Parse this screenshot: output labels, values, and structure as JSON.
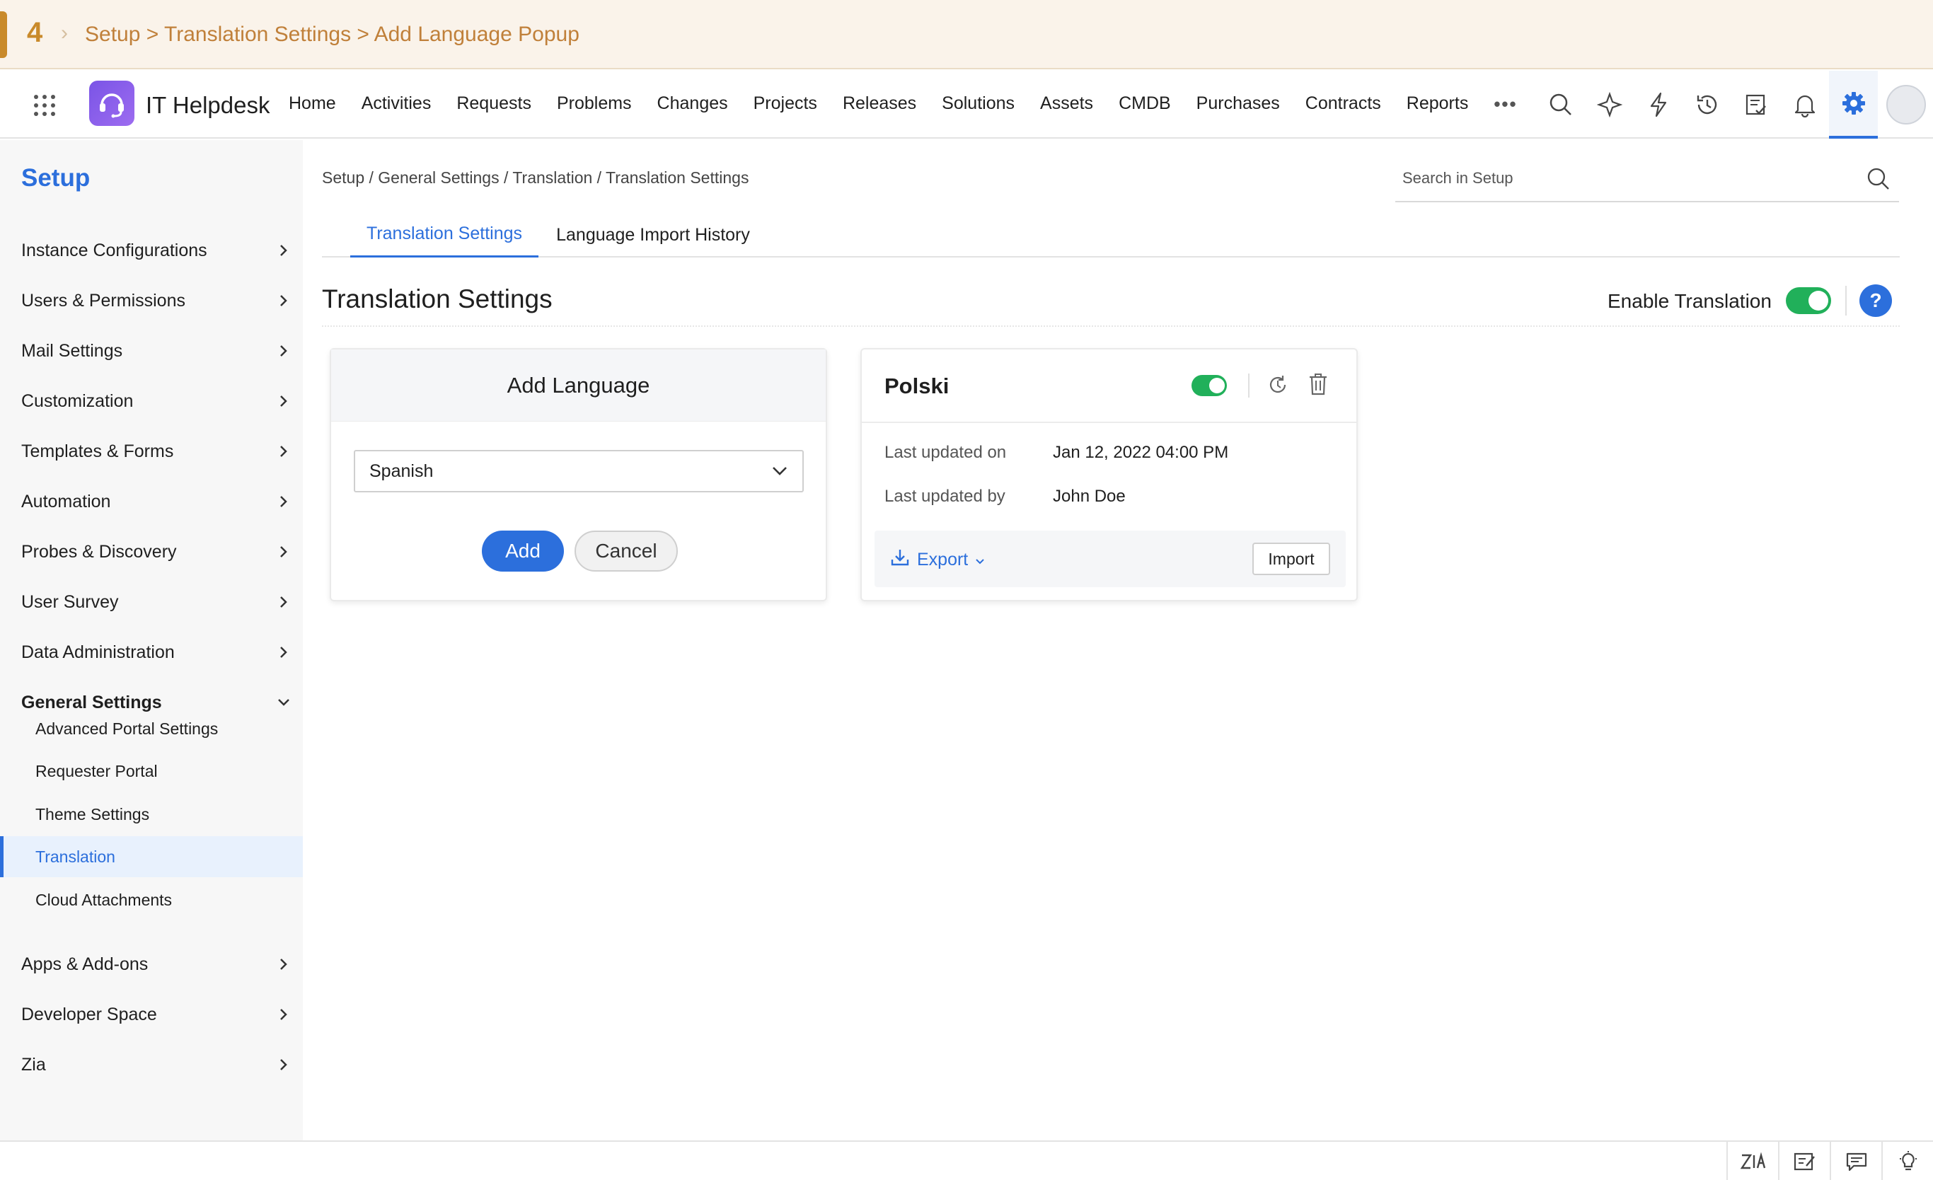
{
  "banner": {
    "step": "4",
    "crumb": "Setup > Translation Settings > Add Language Popup"
  },
  "topnav": {
    "app_title": "IT Helpdesk",
    "items": [
      "Home",
      "Activities",
      "Requests",
      "Problems",
      "Changes",
      "Projects",
      "Releases",
      "Solutions",
      "Assets",
      "CMDB",
      "Purchases",
      "Contracts",
      "Reports"
    ],
    "more": "•••",
    "icons": [
      "search-icon",
      "sparkle-icon",
      "lightning-icon",
      "history-icon",
      "checklist-icon",
      "bell-icon",
      "gear-icon",
      "avatar"
    ]
  },
  "sidebar": {
    "title": "Setup",
    "items": [
      "Instance Configurations",
      "Users & Permissions",
      "Mail Settings",
      "Customization",
      "Templates & Forms",
      "Automation",
      "Probes & Discovery",
      "User Survey",
      "Data Administration",
      "General Settings"
    ],
    "sub_items": [
      "Advanced Portal Settings",
      "Requester Portal",
      "Theme Settings",
      "Translation",
      "Cloud Attachments"
    ],
    "bottom_items": [
      "Apps & Add-ons",
      "Developer Space",
      "Zia"
    ]
  },
  "main": {
    "breadcrumb": "Setup / General Settings / Translation / Translation Settings",
    "search_placeholder": "Search in Setup",
    "tabs": [
      "Translation Settings",
      "Language Import History"
    ],
    "page_title": "Translation Settings",
    "enable_label": "Enable Translation",
    "enable_on": true,
    "help": "?"
  },
  "add_card": {
    "title": "Add Language",
    "selected": "Spanish",
    "add_label": "Add",
    "cancel_label": "Cancel"
  },
  "lang_card": {
    "name": "Polski",
    "enabled": true,
    "updated_on_label": "Last updated on",
    "updated_on": "Jan 12, 2022 04:00 PM",
    "updated_by_label": "Last updated by",
    "updated_by": "John Doe",
    "export_label": "Export",
    "import_label": "Import"
  },
  "colors": {
    "accent": "#2c6fdc",
    "toggle_on": "#21b05a",
    "banner_text": "#c0803a"
  }
}
